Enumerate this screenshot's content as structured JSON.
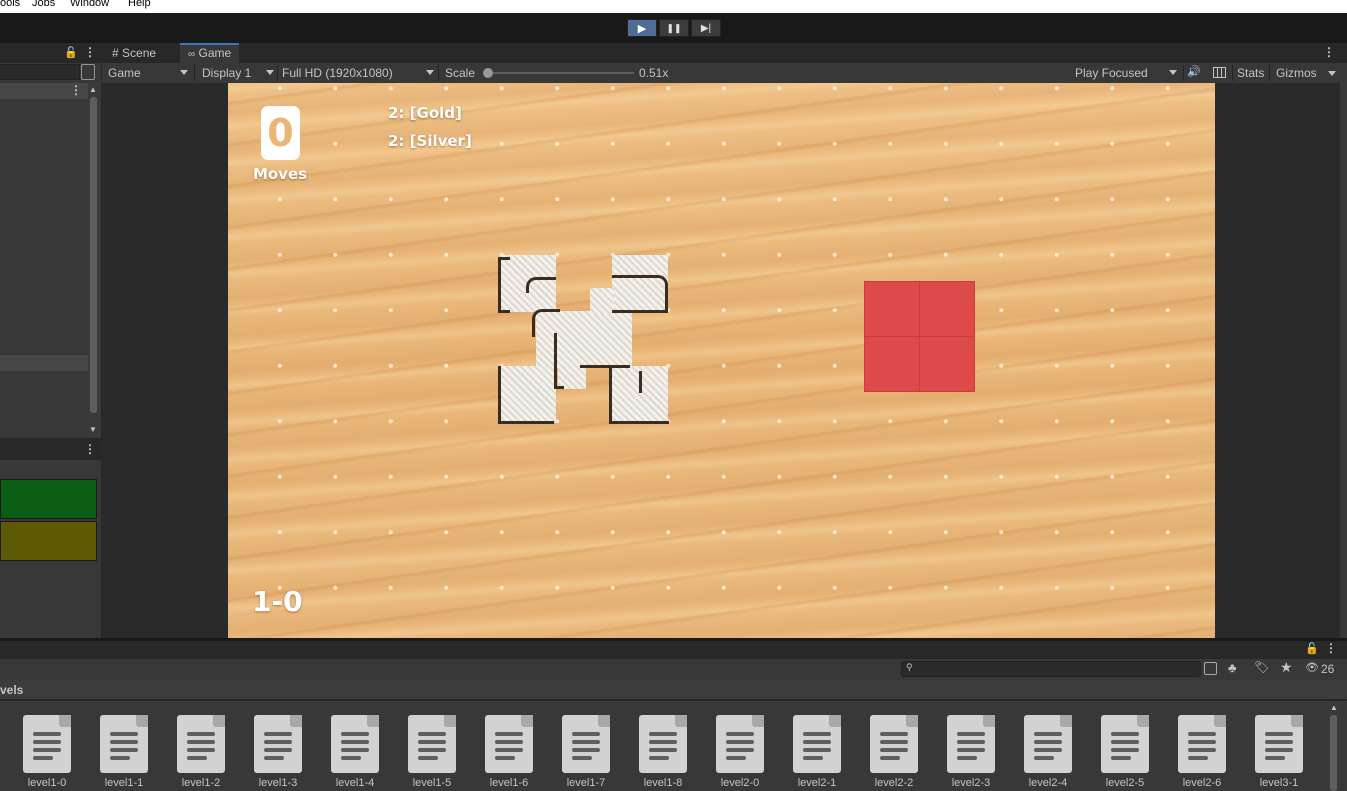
{
  "menu": [
    "ools",
    "Jobs",
    "Window",
    "Help"
  ],
  "play_controls": {
    "play": "▶",
    "pause": "❚❚",
    "step": "▶|"
  },
  "game_tabs": {
    "scene": "Scene",
    "game": "Game"
  },
  "game_toolbar": {
    "mode": "Game",
    "display": "Display 1",
    "resolution": "Full HD (1920x1080)",
    "scale_label": "Scale",
    "scale_value": "0.51x",
    "scale_fraction": 0.0,
    "play_focused": "Play Focused",
    "stats": "Stats",
    "gizmos": "Gizmos"
  },
  "hud": {
    "moves_count": "0",
    "moves_label": "Moves",
    "gold_goal": "2: [Gold]",
    "silver_goal": "2: [Silver]",
    "level": "1-0"
  },
  "colors": {
    "accent_play": "#4f6d97",
    "red_block": "#de4a4a",
    "console_green": "#0b5c14",
    "console_olive": "#5c5a05",
    "wood": "#e9b678"
  },
  "project": {
    "folder_label": "vels",
    "hidden_count": "26",
    "search_placeholder": "",
    "files": [
      "level1-0",
      "level1-1",
      "level1-2",
      "level1-3",
      "level1-4",
      "level1-5",
      "level1-6",
      "level1-7",
      "level1-8",
      "level2-0",
      "level2-1",
      "level2-2",
      "level2-3",
      "level2-4",
      "level2-5",
      "level2-6",
      "level3-1"
    ]
  }
}
